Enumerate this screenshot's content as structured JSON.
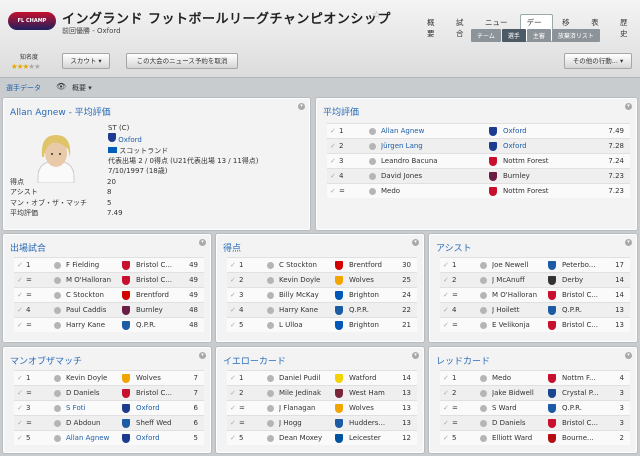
{
  "header": {
    "logo_text": "FL CHAMP",
    "title": "イングランド フットボールリーグチャンピオンシップ",
    "subtitle": "前回優勝 - Oxford",
    "star": "☆",
    "fame_label": "知名度",
    "fame_stars": 3,
    "fame_max": 5,
    "scout_btn": "スカウト ▾",
    "news_btn": "この大会のニュース予約を取消",
    "actions_btn": "その他の行動... ▾"
  },
  "nav": [
    "概要",
    "試合",
    "ニュース",
    "データ",
    "移籍",
    "表彰",
    "歴史"
  ],
  "subnav": [
    "チーム",
    "選手",
    "主審",
    "放棄済リスト"
  ],
  "toolbar": {
    "left": "選手データ",
    "view": "概要 ▾"
  },
  "colors": {
    "title": "#2a6bb8",
    "link": "#1f5fa8",
    "star": "#e5a800"
  },
  "player_panel": {
    "title": "Allan Agnew - 平均評価",
    "position": "ST (C)",
    "club": "Oxford",
    "nation": "スコットランド",
    "caps": "代表出場 2 / 0得点 (U21代表出場 13 / 11得点)",
    "dob": "7/10/1997 (18歳)",
    "stats": [
      {
        "label": "得点",
        "value": "20"
      },
      {
        "label": "アシスト",
        "value": "8"
      },
      {
        "label": "マン・オブ・ザ・マッチ",
        "value": "5"
      },
      {
        "label": "平均評価",
        "value": "7.49"
      }
    ]
  },
  "avg_panel": {
    "title": "平均評価",
    "rows": [
      {
        "rank": "1",
        "name": "Allan Agnew",
        "name_link": true,
        "club": "Oxford",
        "club_link": true,
        "value": "7.49",
        "crest": "#1c3d8f"
      },
      {
        "rank": "2",
        "name": "Jürgen Lang",
        "name_link": true,
        "club": "Oxford",
        "club_link": true,
        "value": "7.28",
        "crest": "#1c3d8f"
      },
      {
        "rank": "3",
        "name": "Leandro Bacuna",
        "club": "Nottm Forest",
        "value": "7.24",
        "crest": "#c8102e"
      },
      {
        "rank": "4",
        "name": "David Jones",
        "club": "Burnley",
        "value": "7.23",
        "crest": "#6c1d45"
      },
      {
        "rank": "=",
        "name": "Medo",
        "club": "Nottm Forest",
        "value": "7.23",
        "crest": "#c8102e"
      }
    ]
  },
  "panels": [
    {
      "title": "出場試合",
      "rows": [
        {
          "rank": "1",
          "name": "F Fielding",
          "club": "Bristol C...",
          "value": "49",
          "crest": "#c8102e"
        },
        {
          "rank": "=",
          "name": "M O'Halloran",
          "club": "Bristol C...",
          "value": "49",
          "crest": "#c8102e"
        },
        {
          "rank": "=",
          "name": "C Stockton",
          "club": "Brentford",
          "value": "49",
          "crest": "#d20000"
        },
        {
          "rank": "4",
          "name": "Paul Caddis",
          "club": "Burnley",
          "value": "48",
          "crest": "#6c1d45"
        },
        {
          "rank": "=",
          "name": "Harry Kane",
          "club": "Q.P.R.",
          "value": "48",
          "crest": "#1d5ba4"
        }
      ]
    },
    {
      "title": "得点",
      "rows": [
        {
          "rank": "1",
          "name": "C Stockton",
          "club": "Brentford",
          "value": "30",
          "crest": "#d20000"
        },
        {
          "rank": "2",
          "name": "Kevin Doyle",
          "club": "Wolves",
          "value": "25",
          "crest": "#f0a500"
        },
        {
          "rank": "3",
          "name": "Billy McKay",
          "club": "Brighton",
          "value": "24",
          "crest": "#0057b8"
        },
        {
          "rank": "4",
          "name": "Harry Kane",
          "club": "Q.P.R.",
          "value": "22",
          "crest": "#1d5ba4"
        },
        {
          "rank": "5",
          "name": "L Ulloa",
          "club": "Brighton",
          "value": "21",
          "crest": "#0057b8"
        }
      ]
    },
    {
      "title": "アシスト",
      "rows": [
        {
          "rank": "1",
          "name": "Joe Newell",
          "club": "Peterbo...",
          "value": "17",
          "crest": "#1d5ba4"
        },
        {
          "rank": "2",
          "name": "J McAnuff",
          "club": "Derby",
          "value": "14",
          "crest": "#333333"
        },
        {
          "rank": "=",
          "name": "M O'Halloran",
          "club": "Bristol C...",
          "value": "14",
          "crest": "#c8102e"
        },
        {
          "rank": "4",
          "name": "J Hoilett",
          "club": "Q.P.R.",
          "value": "13",
          "crest": "#1d5ba4"
        },
        {
          "rank": "=",
          "name": "E Velikonja",
          "club": "Bristol C...",
          "value": "13",
          "crest": "#c8102e"
        }
      ]
    },
    {
      "title": "マンオブザマッチ",
      "rows": [
        {
          "rank": "1",
          "name": "Kevin Doyle",
          "club": "Wolves",
          "value": "7",
          "crest": "#f0a500"
        },
        {
          "rank": "=",
          "name": "D Daniels",
          "club": "Bristol C...",
          "value": "7",
          "crest": "#c8102e"
        },
        {
          "rank": "3",
          "name": "S Foti",
          "name_link": true,
          "club": "Oxford",
          "club_link": true,
          "value": "6",
          "crest": "#1c3d8f"
        },
        {
          "rank": "=",
          "name": "D Abdoun",
          "club": "Sheff Wed",
          "value": "6",
          "crest": "#1d5ba4"
        },
        {
          "rank": "5",
          "name": "Allan Agnew",
          "name_link": true,
          "club": "Oxford",
          "club_link": true,
          "value": "5",
          "crest": "#1c3d8f"
        }
      ]
    },
    {
      "title": "イエローカード",
      "rows": [
        {
          "rank": "1",
          "name": "Daniel Pudil",
          "club": "Watford",
          "value": "14",
          "crest": "#f4d200"
        },
        {
          "rank": "2",
          "name": "Mile Jedinak",
          "club": "West Ham",
          "value": "13",
          "crest": "#7a263a"
        },
        {
          "rank": "=",
          "name": "J Flanagan",
          "club": "Wolves",
          "value": "13",
          "crest": "#f0a500"
        },
        {
          "rank": "=",
          "name": "J Hogg",
          "club": "Hudders...",
          "value": "13",
          "crest": "#1d5ba4"
        },
        {
          "rank": "5",
          "name": "Dean Moxey",
          "club": "Leicester",
          "value": "12",
          "crest": "#0053a0"
        }
      ]
    },
    {
      "title": "レッドカード",
      "rows": [
        {
          "rank": "1",
          "name": "Medo",
          "club": "Nottm F...",
          "value": "4",
          "crest": "#c8102e"
        },
        {
          "rank": "2",
          "name": "Jake Bidwell",
          "club": "Crystal P...",
          "value": "3",
          "crest": "#1b458f"
        },
        {
          "rank": "=",
          "name": "S Ward",
          "club": "Q.P.R.",
          "value": "3",
          "crest": "#1d5ba4"
        },
        {
          "rank": "=",
          "name": "D Daniels",
          "club": "Bristol C...",
          "value": "3",
          "crest": "#c8102e"
        },
        {
          "rank": "5",
          "name": "Elliott Ward",
          "club": "Bourne...",
          "value": "2",
          "crest": "#b50e12"
        }
      ]
    }
  ]
}
